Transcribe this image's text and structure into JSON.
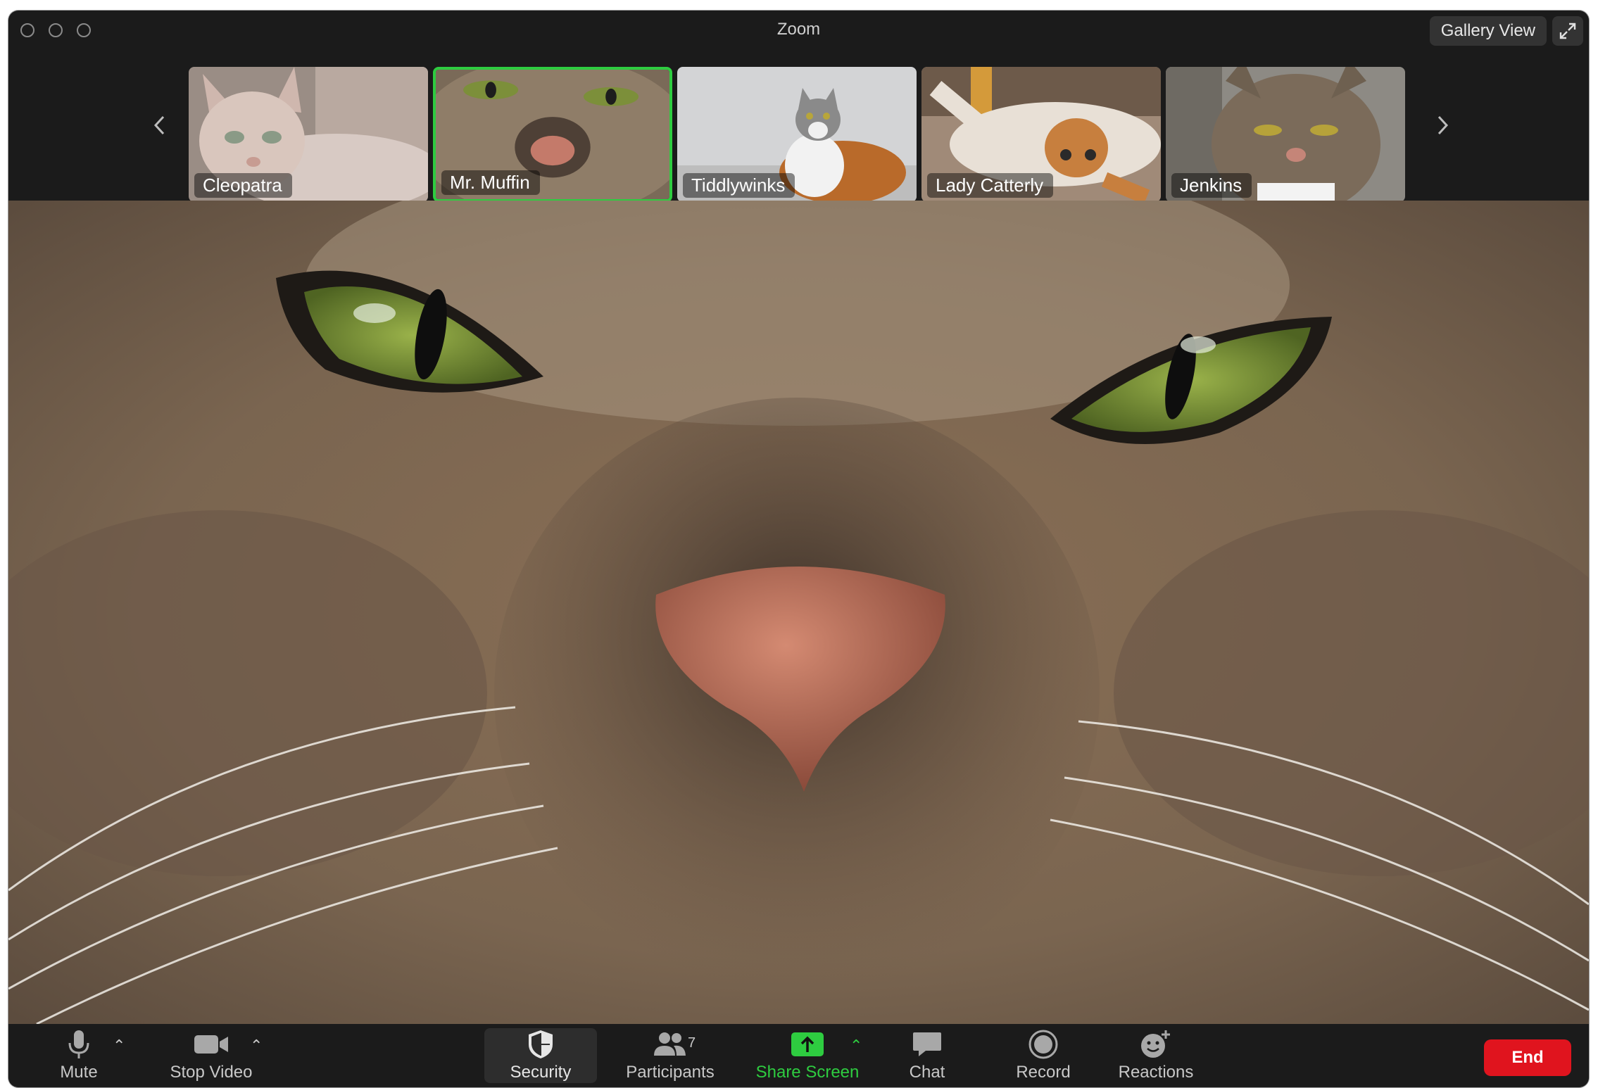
{
  "window": {
    "title": "Zoom"
  },
  "header": {
    "view_label": "Gallery View"
  },
  "participants": [
    {
      "name": "Cleopatra",
      "active": false
    },
    {
      "name": "Mr. Muffin",
      "active": true
    },
    {
      "name": "Tiddlywinks",
      "active": false
    },
    {
      "name": "Lady Catterly",
      "active": false
    },
    {
      "name": "Jenkins",
      "active": false
    }
  ],
  "toolbar": {
    "mute": "Mute",
    "stop_video": "Stop Video",
    "security": "Security",
    "participants": "Participants",
    "participants_count": "7",
    "share_screen": "Share Screen",
    "chat": "Chat",
    "record": "Record",
    "reactions": "Reactions",
    "end": "End"
  },
  "colors": {
    "accent_green": "#2ecc40",
    "end_red": "#e0141e",
    "bar_bg": "#1b1b1b"
  }
}
